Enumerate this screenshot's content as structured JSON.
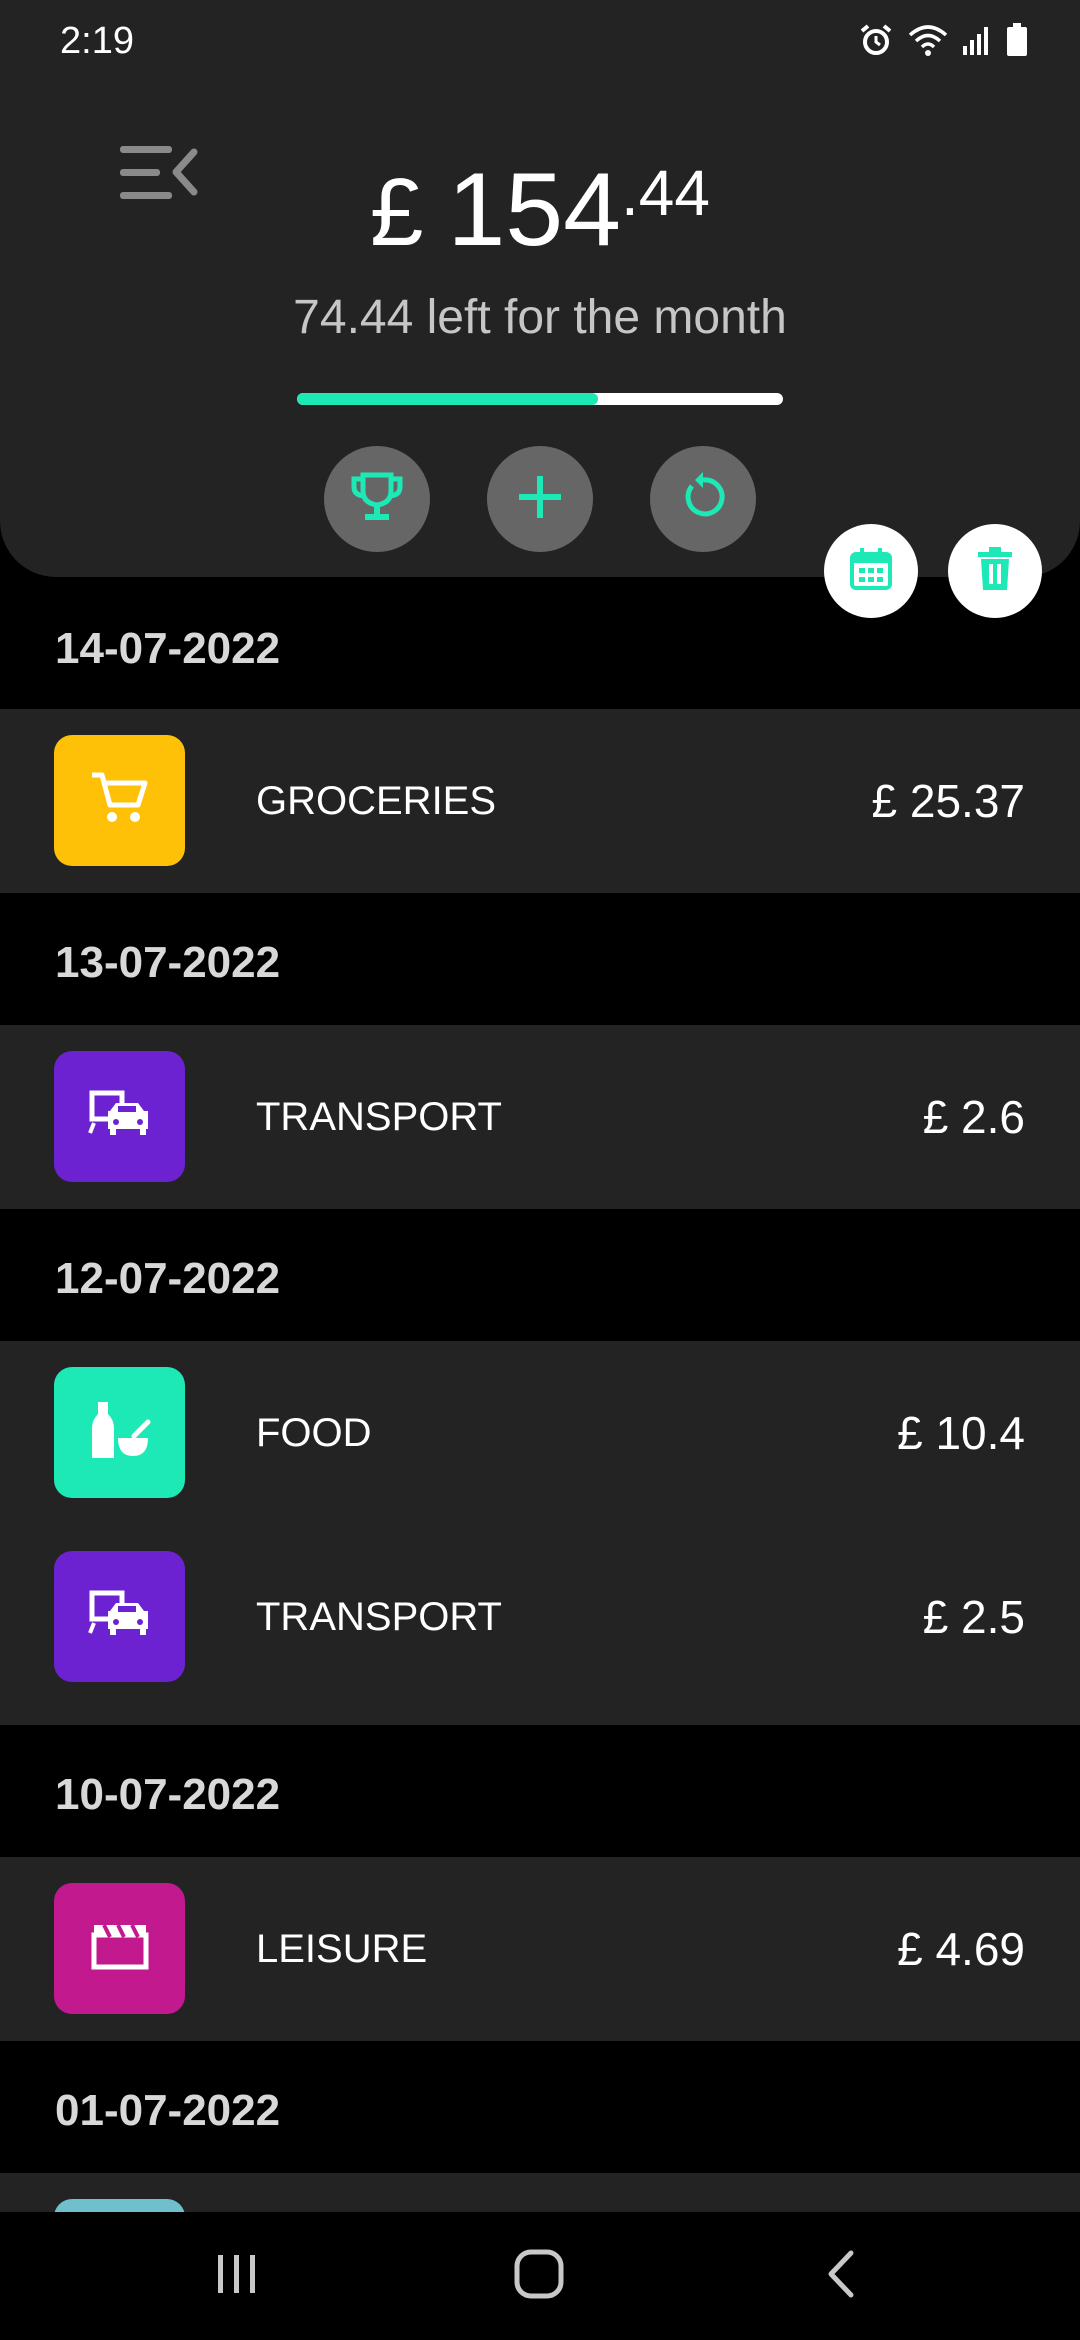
{
  "status_bar": {
    "time": "2:19"
  },
  "header": {
    "menu_icon": "menu-collapse-icon",
    "balance": {
      "currency": "£",
      "whole": "154",
      "decimal": ".44"
    },
    "remaining_text": "74.44 left for the month",
    "progress_fraction": 0.62,
    "actions": [
      {
        "name": "trophy-button",
        "icon": "trophy-icon"
      },
      {
        "name": "add-button",
        "icon": "plus-icon"
      },
      {
        "name": "reset-button",
        "icon": "refresh-icon"
      }
    ],
    "fabs": [
      {
        "name": "calendar-button",
        "icon": "calendar-icon"
      },
      {
        "name": "delete-button",
        "icon": "trash-icon"
      }
    ]
  },
  "colors": {
    "accent": "#1de9b6",
    "groceries": "#ffc107",
    "transport": "#6c22d0",
    "food": "#1de9b6",
    "leisure": "#c2198f",
    "other": "#6fbfcc",
    "card": "#232323",
    "background": "#000000"
  },
  "groups": [
    {
      "date": "14-07-2022",
      "entries": [
        {
          "category": "GROCERIES",
          "amount": "£ 25.37",
          "icon": "cart-icon"
        }
      ]
    },
    {
      "date": "13-07-2022",
      "entries": [
        {
          "category": "TRANSPORT",
          "amount": "£ 2.6",
          "icon": "transport-icon"
        }
      ]
    },
    {
      "date": "12-07-2022",
      "entries": [
        {
          "category": "FOOD",
          "amount": "£ 10.4",
          "icon": "food-icon"
        },
        {
          "category": "TRANSPORT",
          "amount": "£ 2.5",
          "icon": "transport-icon"
        }
      ]
    },
    {
      "date": "10-07-2022",
      "entries": [
        {
          "category": "LEISURE",
          "amount": "£ 4.69",
          "icon": "clapperboard-icon"
        }
      ]
    },
    {
      "date": "01-07-2022",
      "entries": []
    }
  ],
  "nav": {
    "recent_icon": "recent-apps-icon",
    "home_icon": "home-icon",
    "back_icon": "back-icon"
  }
}
